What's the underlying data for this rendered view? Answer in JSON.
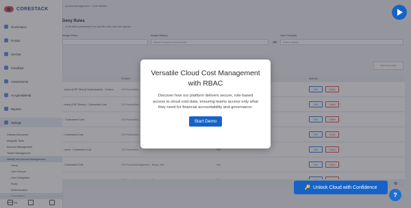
{
  "brand": {
    "name": "CORESTACK"
  },
  "sidebar": {
    "items": [
      {
        "label": "Governance",
        "icon": "governance-icon"
      },
      {
        "label": "FinOps",
        "icon": "finops-icon"
      },
      {
        "label": "SecOps",
        "icon": "secops-icon"
      },
      {
        "label": "CloudOps",
        "icon": "cloudops-icon"
      },
      {
        "label": "Assessments",
        "icon": "assessments-icon"
      },
      {
        "label": "AI Agents(Beta)",
        "icon": "ai-agents-icon"
      },
      {
        "label": "Reports",
        "icon": "reports-icon"
      },
      {
        "label": "Settings",
        "icon": "settings-icon"
      }
    ],
    "sub_items": [
      "Onboard Accounts",
      "Integrate Tools",
      "Account Management",
      "Tenant Management",
      "Identity and Access Management"
    ],
    "iam_items": [
      "Users",
      "User Groups",
      "User Delegation",
      "Roles",
      "Authentication",
      "Cost Metrics"
    ],
    "last_item": "Audit log"
  },
  "main": {
    "breadcrumb": "... Access Management > Cost Metrics",
    "title": "Deny Rules",
    "description": "... of sensitive parameters for specific roles and user groups",
    "filter_labels": [
      "Assign Policy",
      "Assign Role(s)",
      "User Group(s)"
    ],
    "select_placeholders": [
      "Select Tenant to list products",
      "Select Option"
    ],
    "or_label": "OR",
    "add_button": "Add Deny Rule",
    "columns": [
      "Product",
      "Actions"
    ],
    "rows": [
      {
        "name": "...tment (CSP Direct) Subscriptions - Contra...",
        "product": "CS ProductMa...",
        "na": "N/A"
      },
      {
        "name": "...ment (CSP Direct) - Contracted Cost",
        "product": "CS ProductMa...",
        "na": "N/A"
      },
      {
        "name": "... Contracted Cost",
        "product": "CS ProductMa...",
        "na": "N/A"
      },
      {
        "name": "...Contracted Cost",
        "product": "CS ProductMa...",
        "na": "N/A"
      },
      {
        "name": "...ment - Contracted Cost",
        "product": "CS ProductMa...",
        "na": "N/A"
      },
      {
        "name": "...Contracted Cost",
        "product": "CS ProductManagement , Bingo_dev",
        "na": "N/A"
      },
      {
        "name": "...st",
        "product": "CS ProductManagement , Bingo_dev",
        "na": "N/A"
      }
    ],
    "edit_label": "Edit",
    "delete_label": "Delete"
  },
  "modal": {
    "title": "Versatile Cloud Cost Management with RBAC",
    "body": "Discover how our platform delivers secure, role-based access to cloud cost data, ensuring teams access only what they need for financial accountability and governance.",
    "button": "Start Demo"
  },
  "unlock": {
    "label": "Unlock Cloud with Confidence",
    "icon": "key-icon"
  },
  "help": {
    "label": "?"
  },
  "colors": {
    "accent": "#1663c7",
    "delete": "#d9473f",
    "brand_red": "#e2463f"
  }
}
